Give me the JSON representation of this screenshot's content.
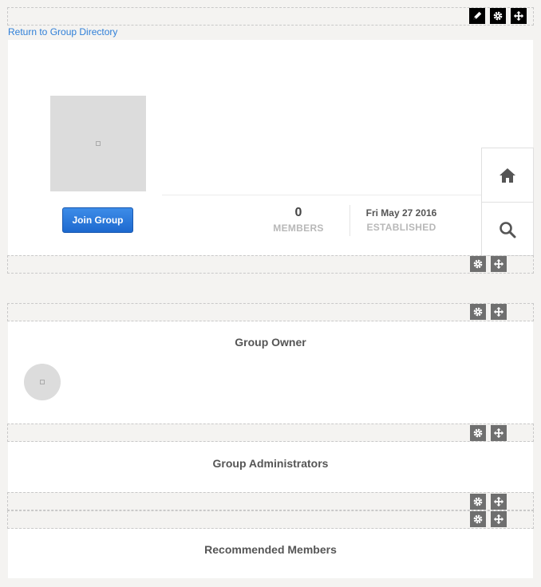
{
  "links": {
    "return": "Return to Group Directory"
  },
  "group": {
    "join_label": "Join Group",
    "members_count": "0",
    "members_label": "MEMBERS",
    "established_date": "Fri May 27 2016",
    "established_label": "ESTABLISHED"
  },
  "sections": {
    "owner": "Group Owner",
    "administrators": "Group Administrators",
    "recommended": "Recommended Members"
  },
  "icons": {
    "edit": "pencil-icon",
    "settings": "gear-icon",
    "move": "move-arrows-icon",
    "home": "home-icon",
    "search": "search-icon"
  },
  "colors": {
    "link": "#2f7fd8",
    "button": "#1d69cf",
    "toolbar_dark": "#000000",
    "toolbar_grey": "#6f6f6f"
  }
}
